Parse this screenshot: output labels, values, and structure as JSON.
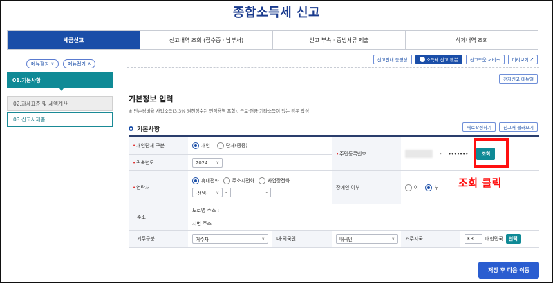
{
  "page": {
    "title": "종합소득세 신고"
  },
  "tabs": [
    {
      "label": "세금신고",
      "active": true
    },
    {
      "label": "신고내역 조회 (접수증 · 납부서)",
      "active": false
    },
    {
      "label": "신고 부속 · 증빙서류 제출",
      "active": false
    },
    {
      "label": "삭제내역 조회",
      "active": false
    }
  ],
  "menu_controls": {
    "expand": "메뉴펼침",
    "collapse": "메뉴접기"
  },
  "sidebar": {
    "items": [
      {
        "label": "01.기본사항",
        "state": "active"
      },
      {
        "label": "02.과세표준 및 세액계산",
        "state": "disabled"
      },
      {
        "label": "03.신고서제출",
        "state": "normal"
      }
    ]
  },
  "toolbar": {
    "video": "신고안내 동영상",
    "chatbot": "소득세 신고 챗봇",
    "assist": "신고도움 서비스",
    "preview": "미리보기",
    "manual": "전자신고 매뉴얼"
  },
  "section": {
    "title": "기본정보 입력",
    "note": "※ 단순경비율 사업소득(3.3% 원천징수된 인적용역 포함), 근로·연금·기타소득이 있는 경우 작성",
    "sub_title": "기본사항",
    "new_write": "새로작성하기",
    "load": "신고서 불러오기"
  },
  "form": {
    "person_type_label": "개인단체 구분",
    "person_type_options": [
      "개인",
      "단체(중중)"
    ],
    "resident_no_label": "주민등록번호",
    "resident_dash": "-",
    "resident_back": "•••••••",
    "lookup_button": "조회",
    "year_label": "귀속년도",
    "year_value": "2024",
    "contact_label": "연락처",
    "contact_options": [
      "휴대전화",
      "주소지전화",
      "사업장전화"
    ],
    "contact_select": "-선택-",
    "contact_dash": "-",
    "disability_label": "장애인 여부",
    "disability_options": [
      "여",
      "부"
    ],
    "address_label": "주소",
    "road_address": "도로명 주소 :",
    "lot_address": "지번 주소 :",
    "residence_label": "거주구분",
    "residence_value": "거주자",
    "nationality_label": "내·외국인",
    "nationality_value": "내국인",
    "country_label": "거주지국",
    "country_code": "KR",
    "country_name": "대한민국",
    "country_select": "선택"
  },
  "annotation": {
    "text": "조회 클릭",
    "color": "#ff1010"
  },
  "footer": {
    "save": "저장 후 다음 이동"
  },
  "colors": {
    "primary": "#1a4ea8",
    "teal": "#0f8a96",
    "annotation": "#ff1010"
  }
}
